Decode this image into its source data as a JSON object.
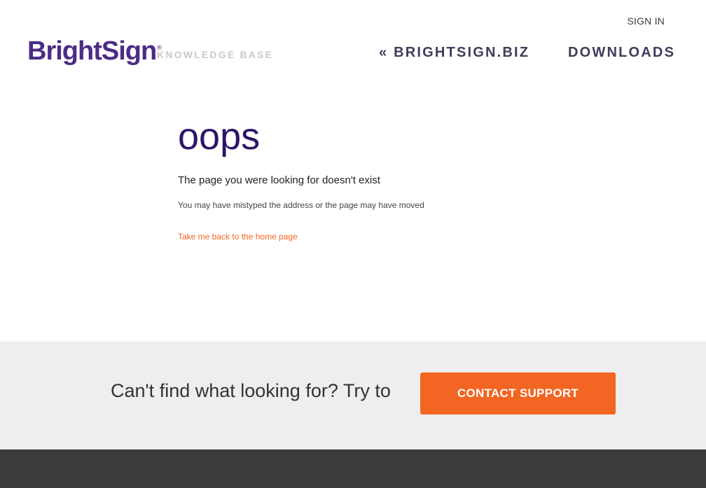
{
  "header": {
    "sign_in": "SIGN IN",
    "logo_text": "BrightSign",
    "logo_mark": "®",
    "subtitle": "KNOWLEDGE BASE",
    "nav": [
      {
        "label": "« BRIGHTSIGN.BIZ"
      },
      {
        "label": "DOWNLOADS"
      }
    ]
  },
  "error": {
    "title": "oops",
    "message": "The page you were looking for doesn't exist",
    "detail": "You may have mistyped the address or the page may have moved",
    "home_link": "Take me back to the home page"
  },
  "support_band": {
    "text": "Can't find what looking for? Try to",
    "button": "CONTACT SUPPORT"
  },
  "colors": {
    "brand_purple": "#4b2c85",
    "accent_orange": "#f26522",
    "band_bg": "#eeeeee",
    "footer_bg": "#3b3b3b"
  }
}
